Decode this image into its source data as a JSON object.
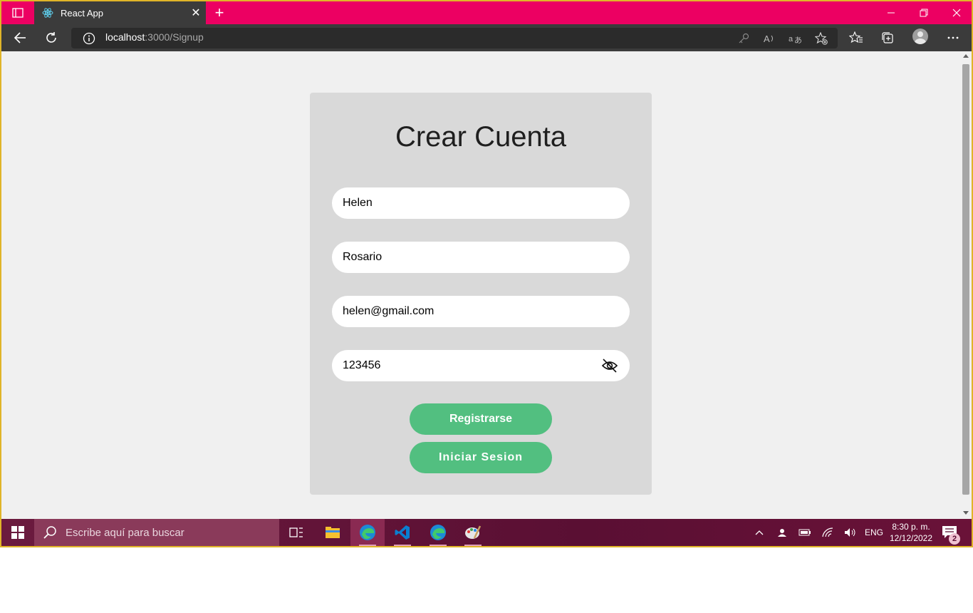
{
  "browser": {
    "tab_title": "React App",
    "url_host": "localhost",
    "url_path": ":3000/Signup"
  },
  "form": {
    "title": "Crear Cuenta",
    "first_name": "Helen",
    "last_name": "Rosario",
    "email": "helen@gmail.com",
    "password": "123456",
    "register_label": "Registrarse",
    "login_label": "Iniciar Sesion"
  },
  "taskbar": {
    "search_placeholder": "Escribe aquí para buscar",
    "language": "ENG",
    "time": "8:30 p. m.",
    "date": "12/12/2022",
    "notification_count": "2"
  },
  "colors": {
    "titlebar": "#ec0062",
    "card": "#d9d9d9",
    "button": "#52bf80"
  }
}
